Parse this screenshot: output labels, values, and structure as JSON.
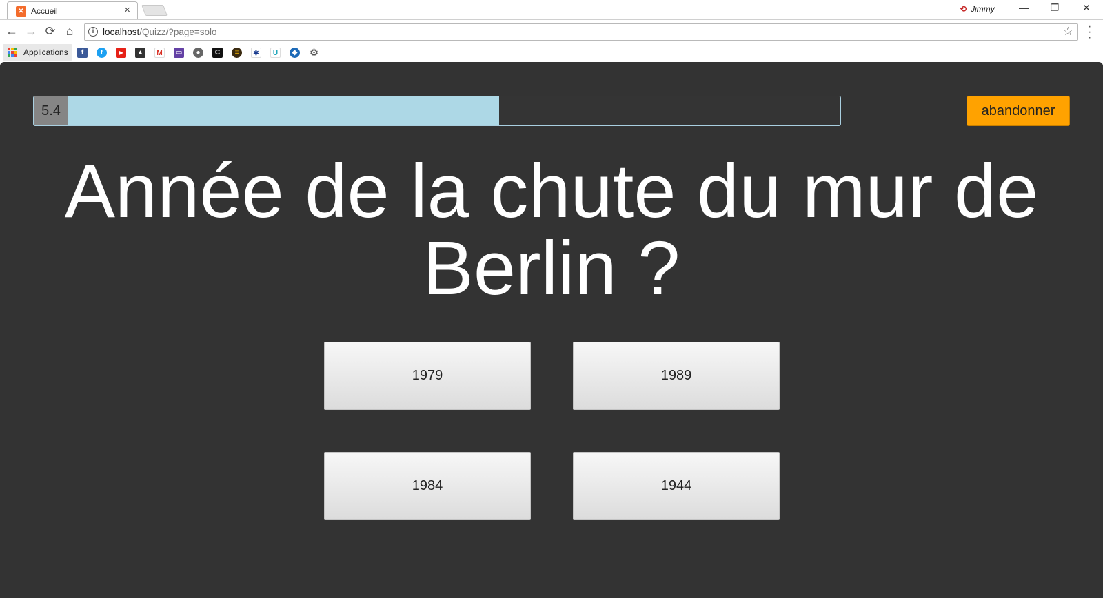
{
  "browser": {
    "tab_title": "Accueil",
    "tab_close": "×",
    "profile_name": "Jimmy",
    "window_controls": {
      "minimize": "—",
      "restore": "❐",
      "close": "✕"
    },
    "url_host": "localhost",
    "url_path": "/Quizz/?page=solo",
    "bookmarks_apps_label": "Applications",
    "bookmark_icons": [
      "facebook-icon",
      "twitter-icon",
      "youtube-icon",
      "picture-icon",
      "gmail-icon",
      "twitch-icon",
      "coin-icon",
      "bookmark-c-icon",
      "burger-icon",
      "people-icon",
      "u-icon",
      "cloud-icon",
      "gear-icon"
    ]
  },
  "quiz": {
    "timer_value": "5.4",
    "timer_progress": 0.577,
    "quit_label": "abandonner",
    "question": "Année de la chute du mur de Berlin ?",
    "answers": [
      "1979",
      "1989",
      "1984",
      "1944"
    ]
  },
  "colors": {
    "page_bg": "#333333",
    "timer_fill": "#add8e6",
    "quit_button": "#ffa200"
  }
}
